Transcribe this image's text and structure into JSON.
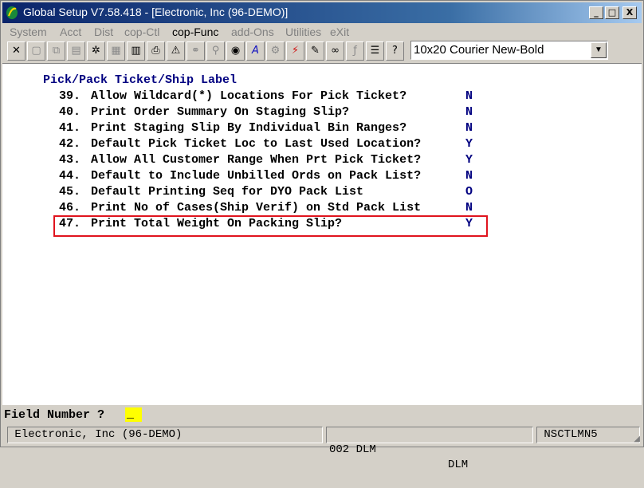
{
  "window": {
    "title": "Global Setup V7.58.418 - [Electronic, Inc (96-DEMO)]",
    "controls": {
      "minimize": "_",
      "maximize": "□",
      "close": "X"
    }
  },
  "menu": [
    "System",
    "Acct",
    "Dist",
    "cop-Ctl",
    "cop-Func",
    "add-Ons",
    "Utilities",
    "eXit"
  ],
  "toolbar": {
    "icons": [
      "close-icon",
      "blank-icon",
      "copy-icon",
      "paste-icon",
      "settings-icon",
      "properties-icon",
      "notes-icon",
      "print-icon",
      "alert-icon",
      "binoculars-icon",
      "search-icon",
      "globe-icon",
      "font-icon",
      "gear-icon",
      "lightning-icon",
      "edit-icon",
      "link-icon",
      "function-icon",
      "list-icon",
      "help-icon"
    ],
    "font_value": "10x20 Courier New-Bold"
  },
  "screen": {
    "heading": "Pick/Pack Ticket/Ship Label",
    "items": [
      {
        "num": "39.",
        "label": "Allow Wildcard(*) Locations For Pick Ticket?",
        "value": "N"
      },
      {
        "num": "40.",
        "label": "Print Order Summary On Staging Slip?",
        "value": "N"
      },
      {
        "num": "41.",
        "label": "Print Staging Slip By Individual Bin Ranges?",
        "value": "N"
      },
      {
        "num": "42.",
        "label": "Default Pick Ticket Loc to Last Used Location?",
        "value": "Y"
      },
      {
        "num": "43.",
        "label": "Allow All Customer Range When Prt Pick Ticket?",
        "value": "Y"
      },
      {
        "num": "44.",
        "label": "Default to Include Unbilled Ords on Pack List?",
        "value": "N"
      },
      {
        "num": "45.",
        "label": "Default Printing Seq for DYO Pack List",
        "value": "O"
      },
      {
        "num": "46.",
        "label": "Print No of Cases(Ship Verif) on Std Pack List",
        "value": "N"
      },
      {
        "num": "47.",
        "label": "Print Total Weight On Packing Slip?",
        "value": "Y"
      }
    ]
  },
  "prompt": {
    "label": "Field Number ?",
    "input": "_"
  },
  "status": {
    "company": "Electronic, Inc (96-DEMO)",
    "user_code": "002 DLM",
    "user": "DLM",
    "program": "NSCTLMN5"
  },
  "colors": {
    "highlight_border": "#e0141e",
    "value_text": "#000080",
    "cursor_bg": "#ffff00"
  }
}
